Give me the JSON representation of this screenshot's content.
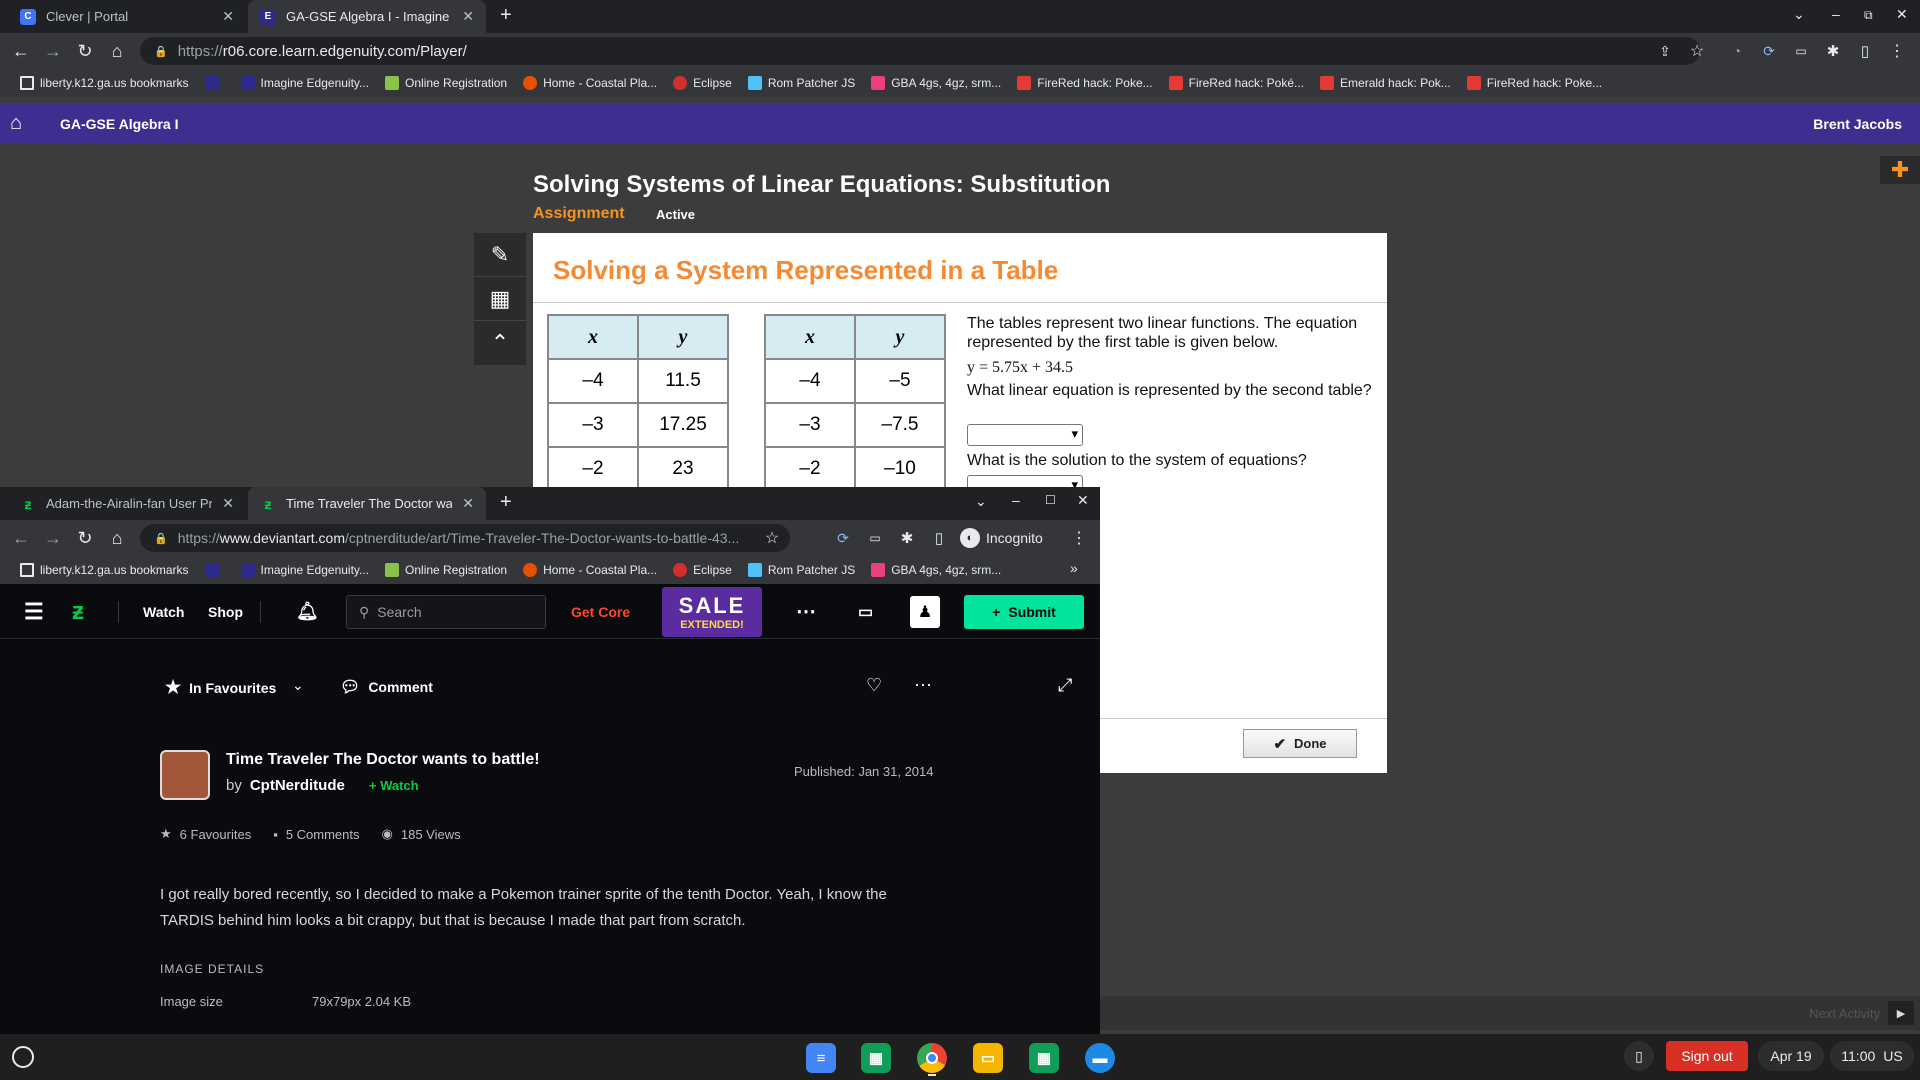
{
  "browser": {
    "tabs": [
      {
        "title": "Clever | Portal",
        "icon": "C",
        "color": "#4274f6"
      },
      {
        "title": "GA-GSE Algebra I - Imagine Edge",
        "icon": "E",
        "color": "#2e2a8c"
      }
    ],
    "url_prefix": "https://",
    "url_host": "r06.core.learn.edgenuity.com",
    "url_path": "/Player/",
    "bookmarks": [
      "liberty.k12.ga.us bookmarks",
      "",
      "Imagine Edgenuity...",
      "Online Registration",
      "Home - Coastal Pla...",
      "Eclipse",
      "Rom Patcher JS",
      "GBA 4gs, 4gz, srm...",
      "FireRed hack: Poke...",
      "FireRed hack: Poké...",
      "Emerald hack: Pok...",
      "FireRed hack: Poke..."
    ]
  },
  "edgenuity": {
    "course": "GA-GSE Algebra I",
    "user": "Brent Jacobs",
    "lesson_title": "Solving Systems of Linear Equations: Substitution",
    "assignment_label": "Assignment",
    "status": "Active",
    "card_title": "Solving a System Represented in a Table",
    "table1": {
      "headers": [
        "x",
        "y"
      ],
      "rows": [
        [
          "–4",
          "11.5"
        ],
        [
          "–3",
          "17.25"
        ],
        [
          "–2",
          "23"
        ]
      ]
    },
    "table2": {
      "headers": [
        "x",
        "y"
      ],
      "rows": [
        [
          "–4",
          "–5"
        ],
        [
          "–3",
          "–7.5"
        ],
        [
          "–2",
          "–10"
        ]
      ]
    },
    "question_intro": "The tables represent two linear functions. The equation represented by the first table is given below.",
    "equation": "y = 5.75x + 34.5",
    "question1": "What linear equation is represented by the second table?",
    "question2": "What is the solution to the system of equations?",
    "done_label": "Done",
    "next_activity": "Next Activity"
  },
  "popup": {
    "tabs": [
      {
        "title": "Adam-the-Airalin-fan User Profil"
      },
      {
        "title": "Time Traveler The Doctor wants"
      }
    ],
    "url_prefix": "https://",
    "url_host": "www.deviantart.com",
    "url_path": "/cptnerditude/art/Time-Traveler-The-Doctor-wants-to-battle-43...",
    "incognito_label": "Incognito",
    "bookmarks": [
      "liberty.k12.ga.us bookmarks",
      "",
      "Imagine Edgenuity...",
      "Online Registration",
      "Home - Coastal Pla...",
      "Eclipse",
      "Rom Patcher JS",
      "GBA 4gs, 4gz, srm..."
    ],
    "nav": {
      "watch": "Watch",
      "shop": "Shop",
      "search_placeholder": "Search",
      "get_core": "Get Core",
      "sale_line1": "SALE",
      "sale_line2": "EXTENDED!",
      "submit": "Submit"
    },
    "actions": {
      "favourites": "In Favourites",
      "comment": "Comment"
    },
    "art": {
      "title": "Time Traveler The Doctor wants to battle!",
      "by": "by",
      "author": "CptNerditude",
      "watch": "Watch",
      "published": "Published: Jan 31, 2014",
      "favourites": "6 Favourites",
      "comments": "5 Comments",
      "views": "185 Views",
      "description": "I got really bored recently, so I decided to make a Pokemon trainer sprite of the tenth Doctor. Yeah, I know the TARDIS behind him looks a bit crappy, but that is because I made that part from scratch.",
      "details_heading": "IMAGE DETAILS",
      "image_size_label": "Image size",
      "image_size_value": "79x79px 2.04 KB"
    }
  },
  "shelf": {
    "sign_out": "Sign out",
    "date": "Apr 19",
    "time": "11:00",
    "locale": "US"
  }
}
